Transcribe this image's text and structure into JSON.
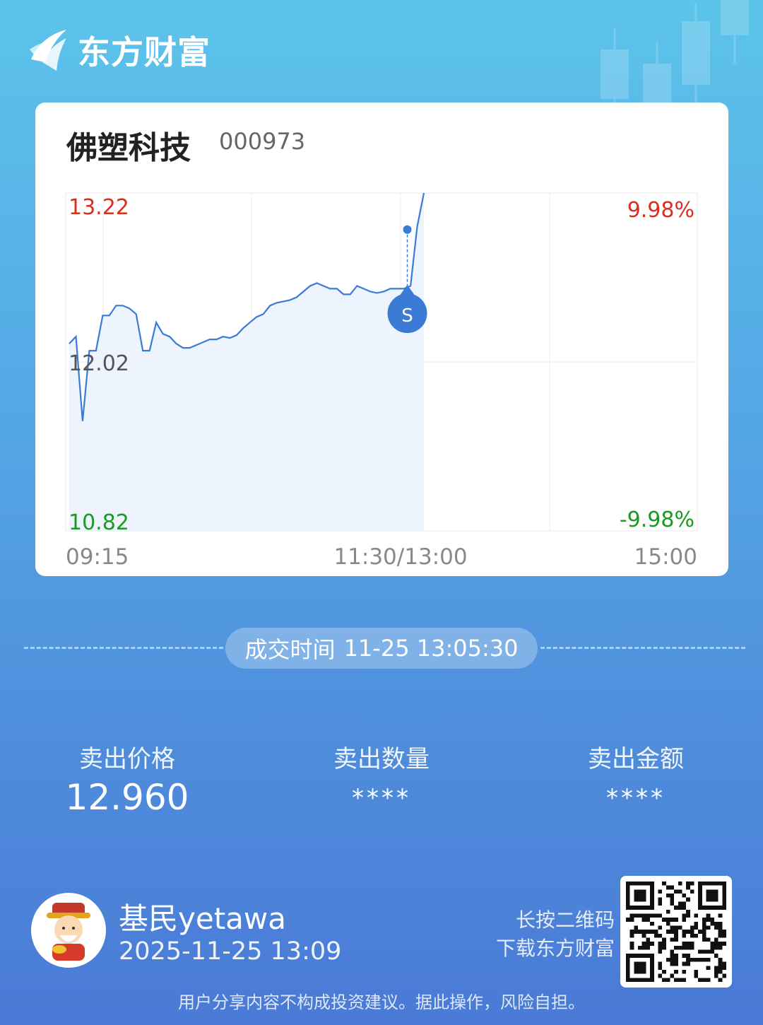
{
  "brand": {
    "name": "东方财富"
  },
  "stock": {
    "name": "佛塑科技",
    "code": "000973"
  },
  "chart_data": {
    "type": "line",
    "title": "",
    "y_ticks": [
      "13.22",
      "12.02",
      "10.82"
    ],
    "pct_ticks": [
      "9.98%",
      "-9.98%"
    ],
    "x_ticks": [
      "09:15",
      "11:30/13:00",
      "15:00"
    ],
    "ylim": [
      10.82,
      13.22
    ],
    "base_price": 12.02,
    "marker": {
      "label": "S",
      "price": 12.96
    },
    "colors": {
      "up": "#d7301f",
      "down": "#1a9a23",
      "line": "#3a7bd5",
      "neutral": "#555555"
    },
    "series": [
      {
        "values": [
          12.15,
          12.2,
          11.6,
          12.1,
          12.1,
          12.35,
          12.35,
          12.42,
          12.42,
          12.4,
          12.36,
          12.1,
          12.1,
          12.3,
          12.22,
          12.2,
          12.15,
          12.12,
          12.12,
          12.14,
          12.16,
          12.18,
          12.18,
          12.2,
          12.19,
          12.21,
          12.26,
          12.3,
          12.34,
          12.36,
          12.42,
          12.44,
          12.45,
          12.46,
          12.48,
          12.52,
          12.56,
          12.58,
          12.56,
          12.54,
          12.54,
          12.5,
          12.5,
          12.56,
          12.54,
          12.52,
          12.51,
          12.52,
          12.54,
          12.54,
          12.54,
          12.56,
          12.98,
          13.22
        ]
      }
    ]
  },
  "deal": {
    "label": "成交时间",
    "time": "11-25 13:05:30"
  },
  "stats": [
    {
      "label": "卖出价格",
      "value": "12.960"
    },
    {
      "label": "卖出数量",
      "value": "****"
    },
    {
      "label": "卖出金额",
      "value": "****"
    }
  ],
  "user": {
    "name": "基民yetawa",
    "time": "2025-11-25 13:09"
  },
  "qr": {
    "line1": "长按二维码",
    "line2": "下载东方财富"
  },
  "disclaimer": "用户分享内容不构成投资建议。据此操作，风险自担。"
}
